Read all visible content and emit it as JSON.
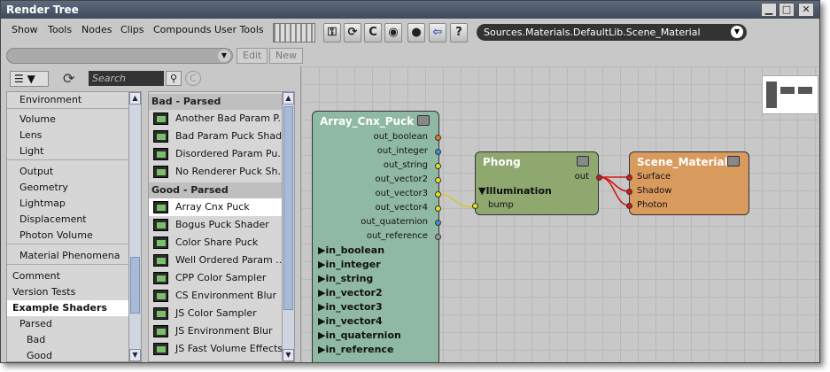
{
  "window": {
    "title": "Render Tree"
  },
  "titlebar_buttons": {
    "minimize": "▁",
    "maximize": "□",
    "close": "✕"
  },
  "menu": {
    "items": [
      "Show",
      "Tools",
      "Nodes",
      "Clips",
      "Compounds",
      "User Tools"
    ]
  },
  "toolbar": {
    "path": "Sources.Materials.DefaultLib.Scene_Material"
  },
  "row2": {
    "edit_label": "Edit",
    "new_label": "New"
  },
  "search": {
    "placeholder": "Search"
  },
  "left_list": {
    "items": [
      {
        "label": "Environment",
        "indent": 1
      },
      {
        "label": "Volume",
        "indent": 1
      },
      {
        "label": "Lens",
        "indent": 1
      },
      {
        "label": "Light",
        "indent": 1
      },
      {
        "label": "Output",
        "indent": 1
      },
      {
        "label": "Geometry",
        "indent": 1
      },
      {
        "label": "Lightmap",
        "indent": 1
      },
      {
        "label": "Displacement",
        "indent": 1
      },
      {
        "label": "Photon Volume",
        "indent": 1
      },
      {
        "label": "Material Phenomena",
        "indent": 1
      },
      {
        "label": "Comment",
        "indent": 0
      },
      {
        "label": "Version Tests",
        "indent": 0
      },
      {
        "label": "Example Shaders",
        "indent": 0
      },
      {
        "label": "Parsed",
        "indent": 1
      },
      {
        "label": "Bad",
        "indent": 2
      },
      {
        "label": "Good",
        "indent": 2
      }
    ]
  },
  "mid_list": {
    "groups": [
      {
        "title": "Bad - Parsed",
        "items": [
          "Another Bad Param P...",
          "Bad Param Puck Shader",
          "Disordered Param Pu...",
          "No Renderer Puck Sh..."
        ]
      },
      {
        "title": "Good - Parsed",
        "items": [
          "Array Cnx Puck",
          "Bogus Puck Shader",
          "Color Share Puck",
          "Well Ordered Param ...",
          "CPP Color Sampler",
          "CS Environment Blur",
          "JS Color Sampler",
          "JS Environment Blur",
          "JS Fast Volume Effects"
        ]
      }
    ]
  },
  "nodes": {
    "array": {
      "title": "Array_Cnx_Puck",
      "outputs": [
        "out_boolean",
        "out_integer",
        "out_string",
        "out_vector2",
        "out_vector3",
        "out_vector4",
        "out_quaternion",
        "out_reference"
      ],
      "output_colors": [
        "#e07a1f",
        "#3d8fd6",
        "#e6e020",
        "#e6e020",
        "#e6e020",
        "#e6e020",
        "#4a8bd6",
        "#9a9a9a"
      ],
      "inputs": [
        "in_boolean",
        "in_integer",
        "in_string",
        "in_vector2",
        "in_vector3",
        "in_vector4",
        "in_quaternion",
        "in_reference"
      ],
      "color": "#8fb9a4"
    },
    "phong": {
      "title": "Phong",
      "out": "out",
      "group": "Illumination",
      "bump": "bump",
      "color": "#8ea870"
    },
    "scene": {
      "title": "Scene_Material",
      "ports": [
        "Surface",
        "Shadow",
        "Photon"
      ],
      "color": "#d99a5e"
    }
  },
  "colors": {
    "selected_row": "#ffffff",
    "title_bg": "#4d596b",
    "wire_red": "#d01818",
    "wire_yellow": "#d8c81a"
  }
}
